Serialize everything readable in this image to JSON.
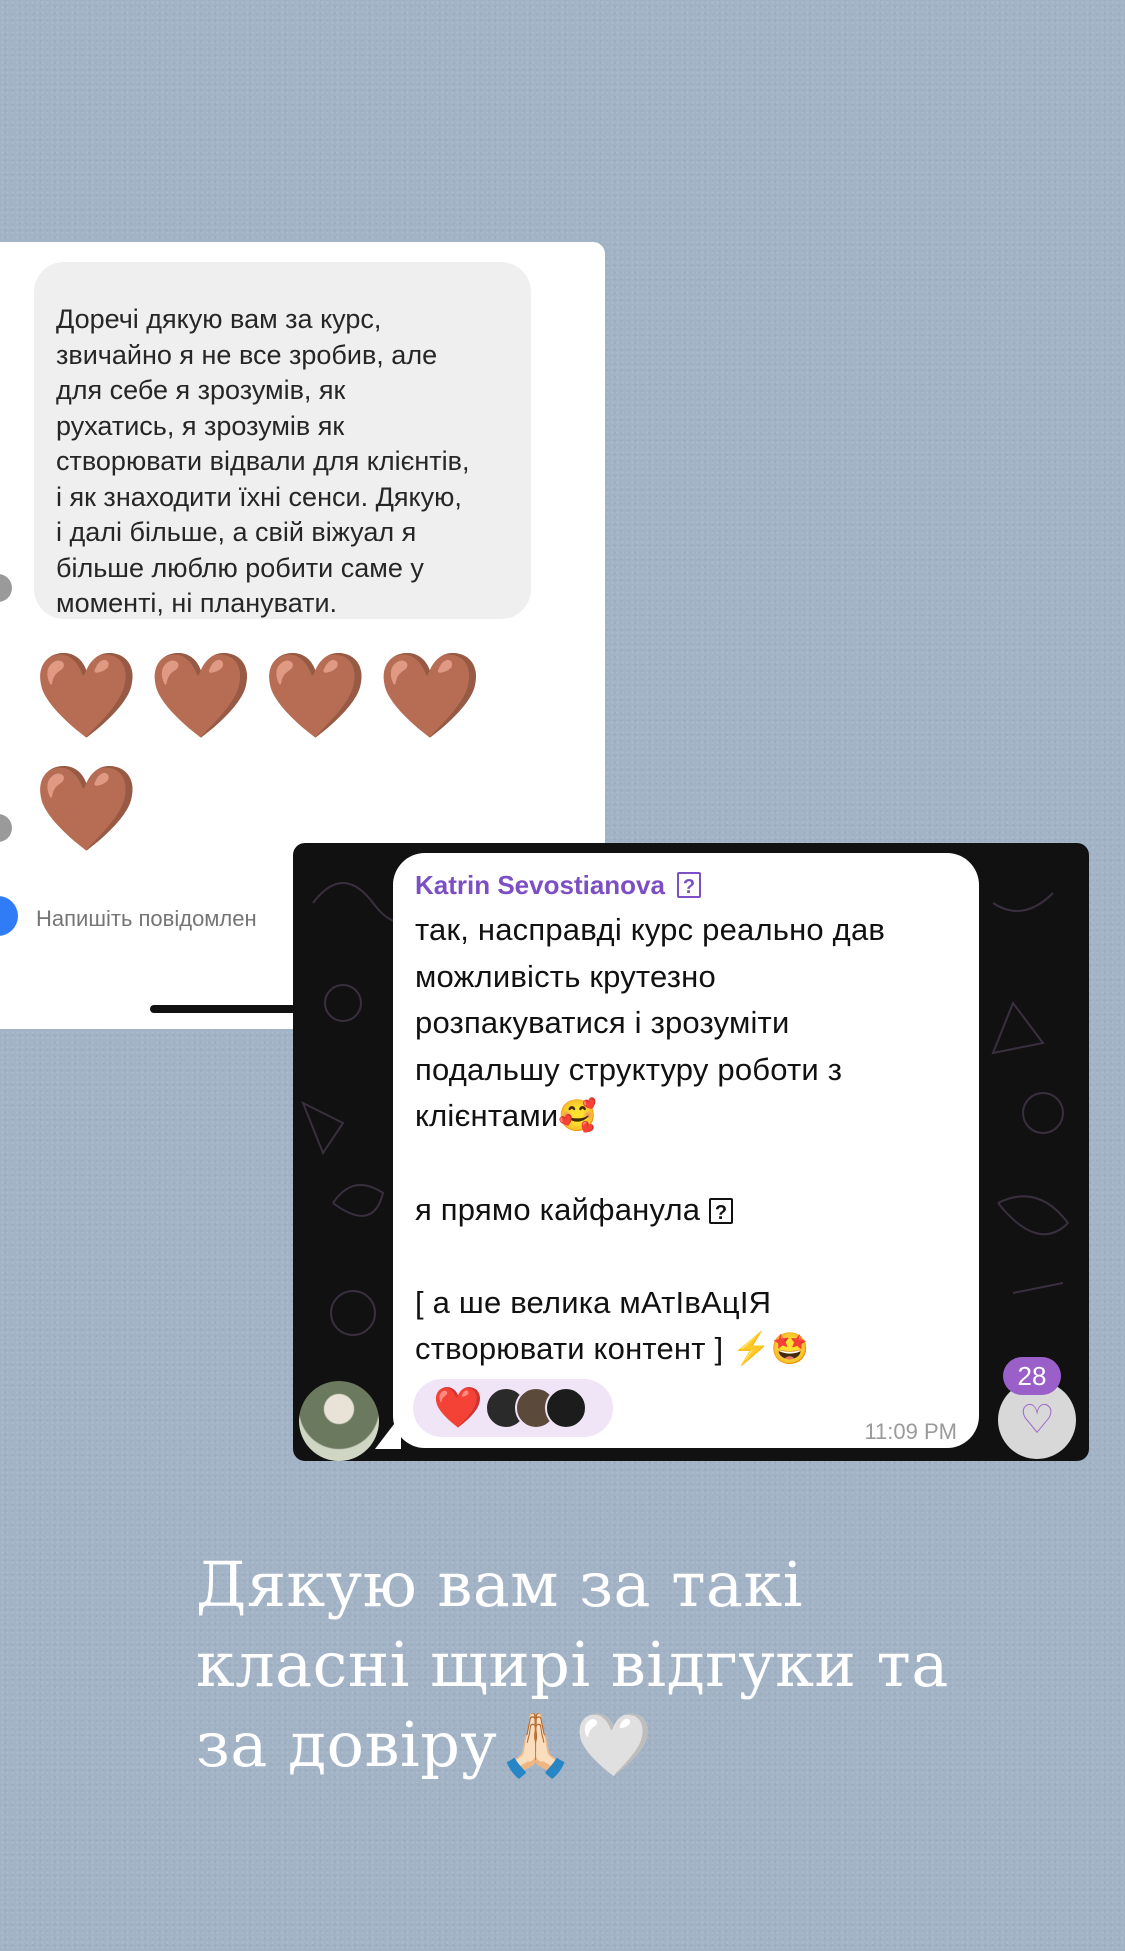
{
  "instagram": {
    "message": "Доречі дякую вам за курс,\nзвичайно я не все зробив, але\nдля себе я зрозумів, як\nрухатись, я зрозумів як\nстворювати відвали для клієнтів,\nі як знаходити їхні сенси. Дякую,\nі далі більше, а свій віжуал я\nбільше люблю робити саме у\nмоменті, ні планувати.",
    "hearts_row1": [
      "🤎",
      "🤎",
      "🤎",
      "🤎"
    ],
    "hearts_row2": [
      "🤎"
    ],
    "composer_placeholder": "Напишіть повідомлен"
  },
  "telegram": {
    "sender": "Katrin Sevostianova",
    "message": "так, насправді курс реально дав\nможливість крутезно\nрозпакуватися і зрозуміти\nподальшу структуру роботи з\nклієнтами🥰\n\nя прямо кайфанула",
    "message_tail": "[ а ше велика мАтІвАцІЯ\nстворювати контент ] ⚡️🤩",
    "reaction": "❤️",
    "time": "11:09 PM",
    "likes": "28",
    "like_icon": "♡",
    "unknown_glyph": "?"
  },
  "caption": "Дякую вам за такі\nкласні щирі відгуки та\nза довіру🙏🏻🤍"
}
